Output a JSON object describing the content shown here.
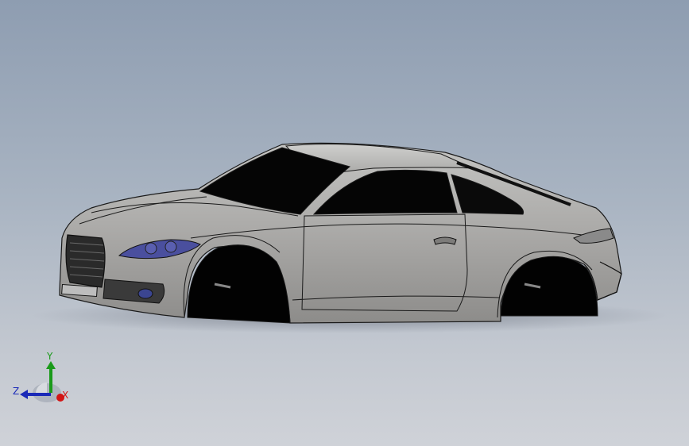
{
  "viewport": {
    "background_top": "#8e9db1",
    "background_bottom": "#cfd2d8"
  },
  "model": {
    "body_color": "#a8a8a6",
    "glass_color": "#050505",
    "headlight_color": "#4a4f9e",
    "edge_color": "#1a1a1a"
  },
  "triad": {
    "x_label": "X",
    "y_label": "Y",
    "z_label": "Z",
    "x_color": "#d21414",
    "y_color": "#1a9a1a",
    "z_color": "#1a2ab8"
  }
}
